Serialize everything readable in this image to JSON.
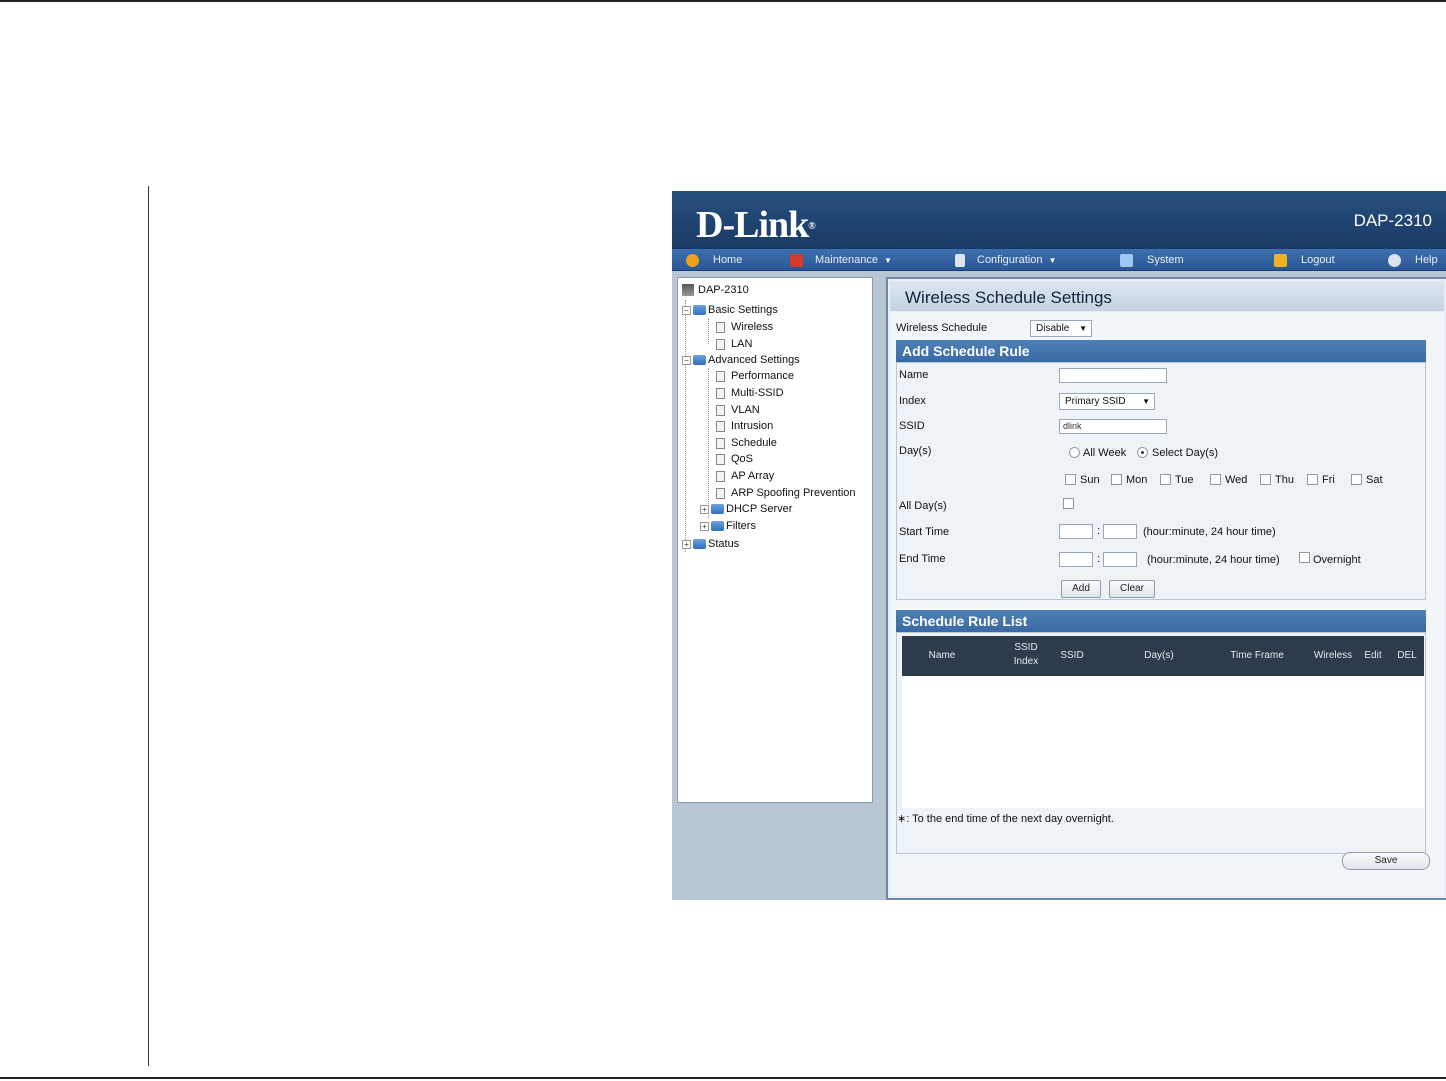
{
  "banner": {
    "logo": "D-Link",
    "logo_mark": "®",
    "model": "DAP-2310"
  },
  "menu": {
    "home": "Home",
    "maintenance": "Maintenance",
    "configuration": "Configuration",
    "system": "System",
    "logout": "Logout",
    "help": "Help"
  },
  "tree": {
    "root": "DAP-2310",
    "basic": "Basic Settings",
    "wireless": "Wireless",
    "lan": "LAN",
    "advanced": "Advanced Settings",
    "performance": "Performance",
    "multi_ssid": "Multi-SSID",
    "vlan": "VLAN",
    "intrusion": "Intrusion",
    "schedule": "Schedule",
    "qos": "QoS",
    "ap_array": "AP Array",
    "arp": "ARP Spoofing Prevention",
    "dhcp": "DHCP Server",
    "filters": "Filters",
    "status": "Status",
    "expand_sign": "+",
    "collapse_sign": "−"
  },
  "main": {
    "title": "Wireless Schedule Settings",
    "wireless_schedule_label": "Wireless Schedule",
    "wireless_schedule_value": "Disable",
    "add_rule_header": "Add Schedule Rule",
    "name_label": "Name",
    "index_label": "Index",
    "index_value": "Primary SSID",
    "ssid_label": "SSID",
    "ssid_value": "dlink",
    "days_label": "Day(s)",
    "all_week": "All Week",
    "select_days": "Select Day(s)",
    "days": [
      "Sun",
      "Mon",
      "Tue",
      "Wed",
      "Thu",
      "Fri",
      "Sat"
    ],
    "all_days_label": "All Day(s)",
    "start_time_label": "Start Time",
    "end_time_label": "End Time",
    "time_separator": ":",
    "time_hint": "(hour:minute, 24 hour time)",
    "overnight": "Overnight",
    "add_button": "Add",
    "clear_button": "Clear",
    "list_header": "Schedule Rule List",
    "columns": {
      "name": "Name",
      "ssid_index_1": "SSID",
      "ssid_index_2": "Index",
      "ssid": "SSID",
      "days": "Day(s)",
      "time_frame": "Time Frame",
      "wireless": "Wireless",
      "edit": "Edit",
      "del": "DEL"
    },
    "note": "∗: To the end time of the next day overnight.",
    "save_button": "Save"
  },
  "colors": {
    "banner": "#1f4371",
    "menubar": "#2b5894",
    "section_header": "#3a6aa3",
    "list_header": "#2d3b4c"
  }
}
